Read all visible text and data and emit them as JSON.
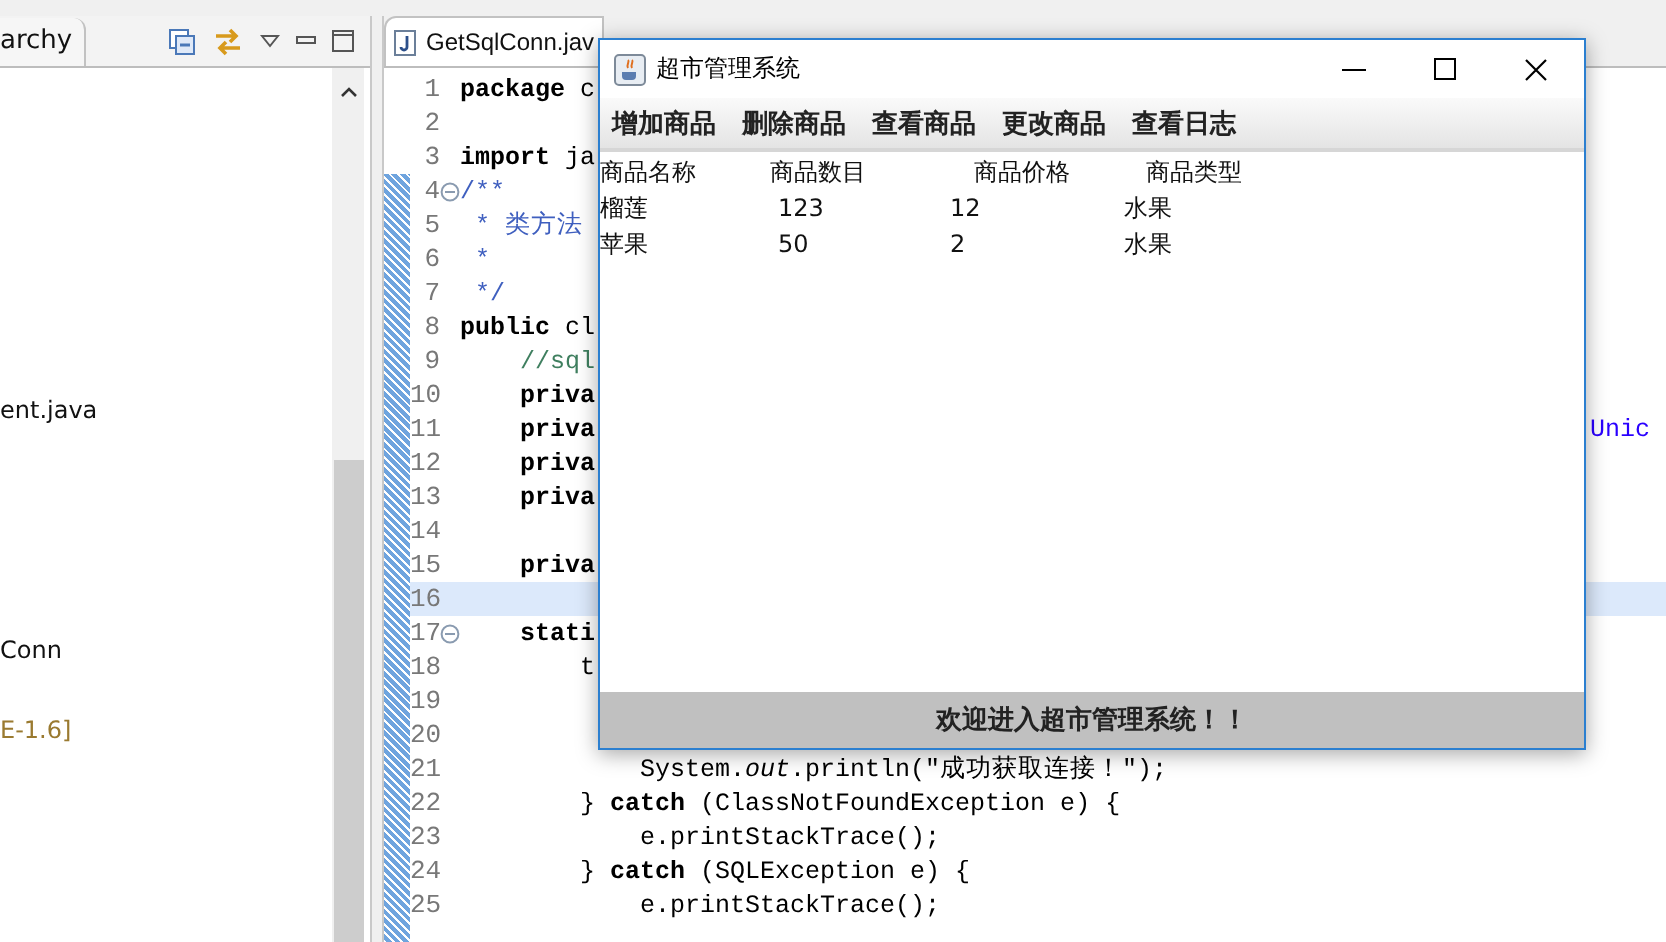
{
  "explorer": {
    "tab": "archy",
    "items": [
      {
        "label": "ent.java",
        "kind": "file"
      },
      {
        "label": "Conn",
        "kind": "file"
      },
      {
        "label": "E-1.6]",
        "kind": "library"
      }
    ]
  },
  "editor": {
    "tab": "GetSqlConn.jav",
    "lines": [
      {
        "number": "1",
        "code": "**package** c",
        "kind": "code",
        "fold": false,
        "current": false
      },
      {
        "number": "2",
        "kind": "code",
        "fold": false,
        "current": false
      },
      {
        "number": "3",
        "code": "**import** ja",
        "kind": "code",
        "fold": false,
        "current": false
      },
      {
        "number": "4",
        "code": "/**",
        "kind": "javadoc",
        "fold": true,
        "current": false
      },
      {
        "number": "5",
        "code": " * 类方法",
        "kind": "javadoc",
        "fold": false,
        "current": false
      },
      {
        "number": "6",
        "code": " *",
        "kind": "javadoc",
        "fold": false,
        "current": false
      },
      {
        "number": "7",
        "code": " */",
        "kind": "javadoc",
        "fold": false,
        "current": false
      },
      {
        "number": "8",
        "code": "**public** cl",
        "kind": "code",
        "fold": false,
        "current": false
      },
      {
        "number": "9",
        "code": "    //sql",
        "kind": "comment",
        "fold": false,
        "current": false
      },
      {
        "number": "10",
        "code": "    **priva**",
        "kind": "code",
        "fold": false,
        "current": false
      },
      {
        "number": "11",
        "code": "    **priva**",
        "kind": "code",
        "fold": false,
        "current": false,
        "tail": "Unic"
      },
      {
        "number": "12",
        "code": "    **priva**",
        "kind": "code",
        "fold": false,
        "current": false
      },
      {
        "number": "13",
        "code": "    **priva**",
        "kind": "code",
        "fold": false,
        "current": false
      },
      {
        "number": "14",
        "kind": "code",
        "fold": false,
        "current": false
      },
      {
        "number": "15",
        "code": "    **priva**",
        "kind": "code",
        "fold": false,
        "current": false
      },
      {
        "number": "16",
        "kind": "code",
        "fold": false,
        "current": true
      },
      {
        "number": "17",
        "code": "    **stati**",
        "kind": "code",
        "fold": true,
        "current": false
      },
      {
        "number": "18",
        "code": "        t",
        "kind": "code",
        "fold": false,
        "current": false
      },
      {
        "number": "19",
        "kind": "code",
        "fold": false,
        "current": false
      },
      {
        "number": "20",
        "kind": "code",
        "fold": false,
        "current": false
      },
      {
        "number": "21",
        "code": "            System.*out*.println(\"成功获取连接！\");",
        "kind": "code",
        "fold": false,
        "current": false
      },
      {
        "number": "22",
        "code": "        } **catch** (ClassNotFoundException e) {",
        "kind": "code",
        "fold": false,
        "current": false
      },
      {
        "number": "23",
        "code": "            e.printStackTrace();",
        "kind": "code",
        "fold": false,
        "current": false
      },
      {
        "number": "24",
        "code": "        } **catch** (SQLException e) {",
        "kind": "code",
        "fold": false,
        "current": false
      },
      {
        "number": "25",
        "code": "            e.printStackTrace();",
        "kind": "code",
        "fold": false,
        "current": false
      }
    ]
  },
  "dialog": {
    "title": "超市管理系统",
    "menu": [
      "增加商品",
      "删除商品",
      "查看商品",
      "更改商品",
      "查看日志"
    ],
    "table": {
      "columns": [
        "商品名称",
        "商品数目",
        "商品价格",
        "商品类型"
      ],
      "rows": [
        [
          "榴莲",
          "123",
          "12",
          "水果"
        ],
        [
          "苹果",
          "50",
          "2",
          "水果"
        ]
      ]
    },
    "status": "欢迎进入超市管理系统！！"
  }
}
